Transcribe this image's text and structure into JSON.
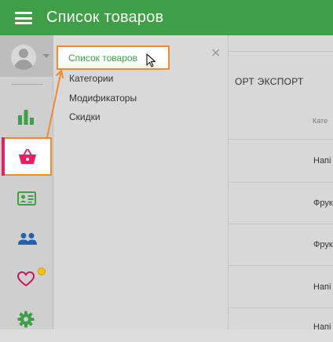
{
  "app": {
    "title": "Список товаров"
  },
  "header": {
    "menu_icon": "hamburger-icon"
  },
  "sidebar": {
    "items": [
      {
        "name": "analytics",
        "icon": "bar-chart-icon"
      },
      {
        "name": "products",
        "icon": "basket-icon",
        "active": true
      },
      {
        "name": "employees",
        "icon": "id-card-icon"
      },
      {
        "name": "customers",
        "icon": "people-icon"
      },
      {
        "name": "loyalty",
        "icon": "heart-icon"
      },
      {
        "name": "settings",
        "icon": "gear-icon"
      }
    ]
  },
  "submenu": {
    "items": [
      {
        "label": "Список товаров",
        "active": true
      },
      {
        "label": "Категории"
      },
      {
        "label": "Модификаторы"
      },
      {
        "label": "Скидки"
      }
    ]
  },
  "background": {
    "actions": "ОРТ  ЭКСПОРТ",
    "column_header": "Кате",
    "rows": [
      "Напі",
      "Фрук",
      "Фрук",
      "Напі",
      "Напі"
    ]
  },
  "colors": {
    "topbar": "#3f9f46",
    "active_accent": "#e91e63",
    "highlight_border": "#f08a30"
  }
}
